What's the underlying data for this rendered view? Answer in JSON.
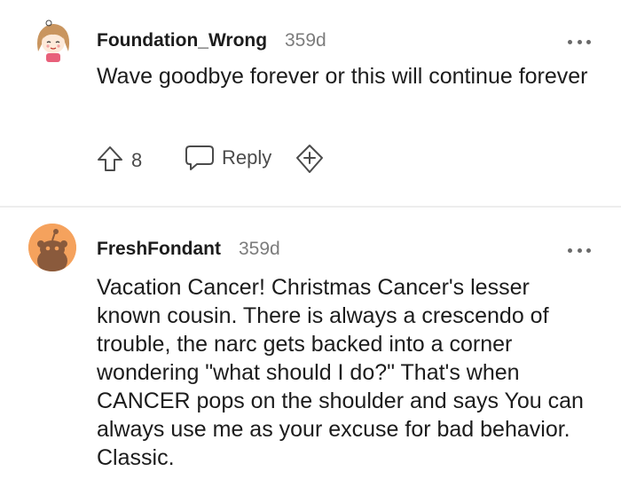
{
  "comments": [
    {
      "author": "Foundation_Wrong",
      "age": "359d",
      "text": "Wave goodbye forever or this will continue forever",
      "score": "8",
      "reply_label": "Reply",
      "avatar": "cartoon-girl-avatar"
    },
    {
      "author": "FreshFondant",
      "age": "359d",
      "text": "Vacation Cancer! Christmas Cancer's lesser known cousin. There is always a crescendo of trouble, the narc gets backed into a corner wondering \"what should I do?\" That's when CANCER pops on the shoulder and says You can always use me as your excuse for bad behavior. Classic.",
      "avatar": "default-snoo-avatar"
    }
  ],
  "colors": {
    "text": "#1c1c1c",
    "muted": "#7c7c7c",
    "icon": "#4b4b4b",
    "divider": "#ededed",
    "avatar_orange": "#f5a25d"
  }
}
